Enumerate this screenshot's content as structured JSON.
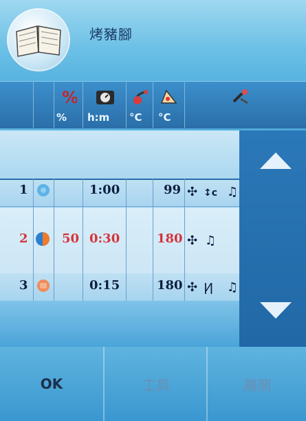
{
  "header": {
    "title": "烤豬腳"
  },
  "columns": {
    "units": [
      "%",
      "h:m",
      "°C",
      "°C"
    ]
  },
  "rows": [
    {
      "num": "1",
      "pct": "",
      "time": "1:00",
      "t1": "",
      "t2": "99",
      "highlight": false
    },
    {
      "num": "2",
      "pct": "50",
      "time": "0:30",
      "t1": "",
      "t2": "180",
      "highlight": true
    },
    {
      "num": "3",
      "pct": "",
      "time": "0:15",
      "t1": "",
      "t2": "180",
      "highlight": false
    }
  ],
  "buttons": {
    "ok": "OK",
    "tools": "工具",
    "exit": "離開"
  },
  "colors": {
    "highlight_text": "#d6333a",
    "normal_text": "#0c1f3f"
  }
}
